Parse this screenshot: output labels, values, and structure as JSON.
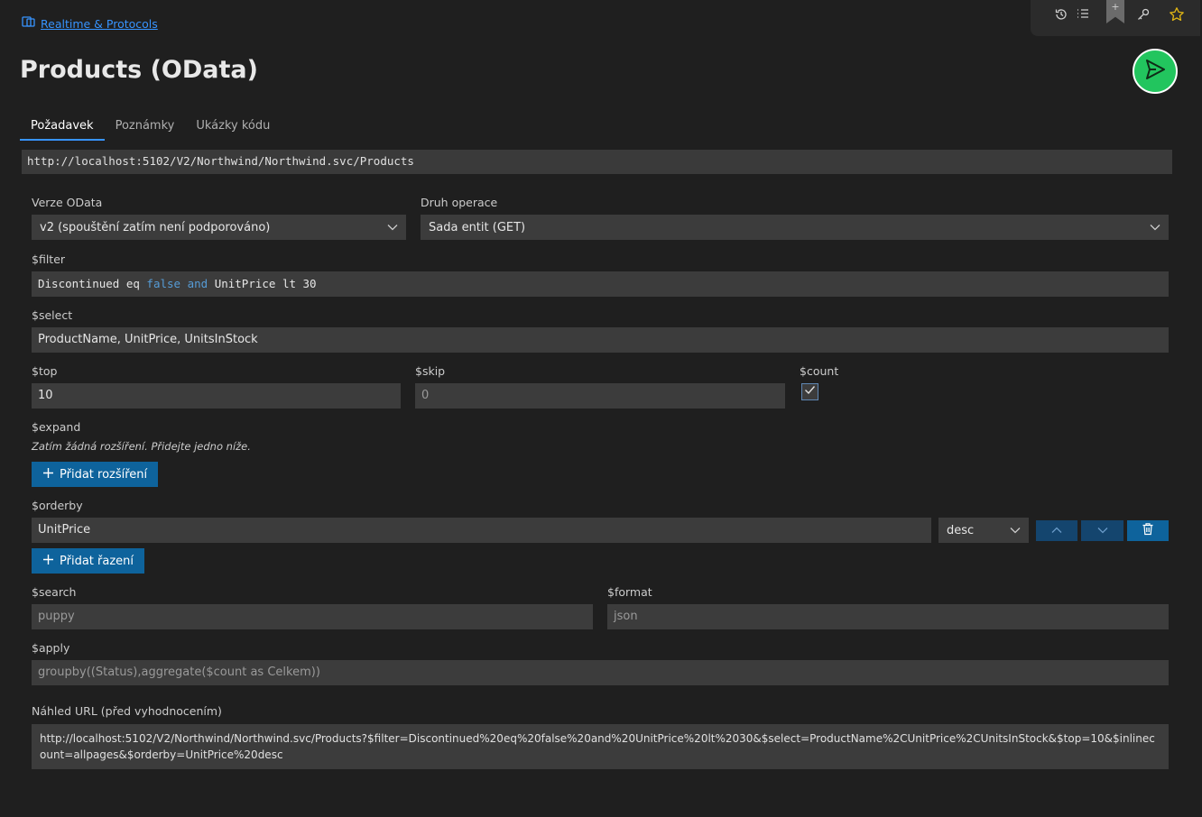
{
  "breadcrumb": {
    "label": "Realtime & Protocols"
  },
  "page": {
    "title": "Products (OData)"
  },
  "tabs": [
    {
      "label": "Požadavek"
    },
    {
      "label": "Poznámky"
    },
    {
      "label": "Ukázky kódu"
    }
  ],
  "request": {
    "url": "http://localhost:5102/V2/Northwind/Northwind.svc/Products"
  },
  "odata_version": {
    "label": "Verze OData",
    "value": "v2 (spouštění zatím není podporováno)"
  },
  "operation": {
    "label": "Druh operace",
    "value": "Sada entit (GET)"
  },
  "filter": {
    "label": "$filter",
    "part1": "Discontinued eq ",
    "kw1": "false",
    "kw2": "and",
    "part2": " UnitPrice lt 30"
  },
  "select": {
    "label": "$select",
    "value": "ProductName, UnitPrice, UnitsInStock"
  },
  "top": {
    "label": "$top",
    "value": "10"
  },
  "skip": {
    "label": "$skip",
    "placeholder": "0"
  },
  "count": {
    "label": "$count",
    "checked": true
  },
  "expand": {
    "label": "$expand",
    "hint": "Zatím žádná rozšíření. Přidejte jedno níže.",
    "add_label": "Přidat rozšíření"
  },
  "orderby": {
    "label": "$orderby",
    "field": "UnitPrice",
    "direction": "desc",
    "add_label": "Přidat řazení"
  },
  "search": {
    "label": "$search",
    "placeholder": "puppy"
  },
  "format": {
    "label": "$format",
    "placeholder": "json"
  },
  "apply": {
    "label": "$apply",
    "placeholder": "groupby((Status),aggregate($count as Celkem))"
  },
  "preview": {
    "label": "Náhled URL (před vyhodnocením)",
    "value": "http://localhost:5102/V2/Northwind/Northwind.svc/Products?$filter=Discontinued%20eq%20false%20and%20UnitPrice%20lt%2030&$select=ProductName%2CUnitPrice%2CUnitsInStock&$top=10&$inlinecount=allpages&$orderby=UnitPrice%20desc"
  },
  "colors": {
    "accent": "#3794ff",
    "send": "#22c55e",
    "primary_button": "#0e639c"
  },
  "icons": [
    "protocol-icon",
    "history-icon",
    "list-icon",
    "bookmark-icon",
    "key-icon",
    "star-icon",
    "send-icon",
    "chevron-down-icon",
    "chevron-up-icon",
    "trash-icon",
    "plus-icon",
    "check-icon"
  ]
}
